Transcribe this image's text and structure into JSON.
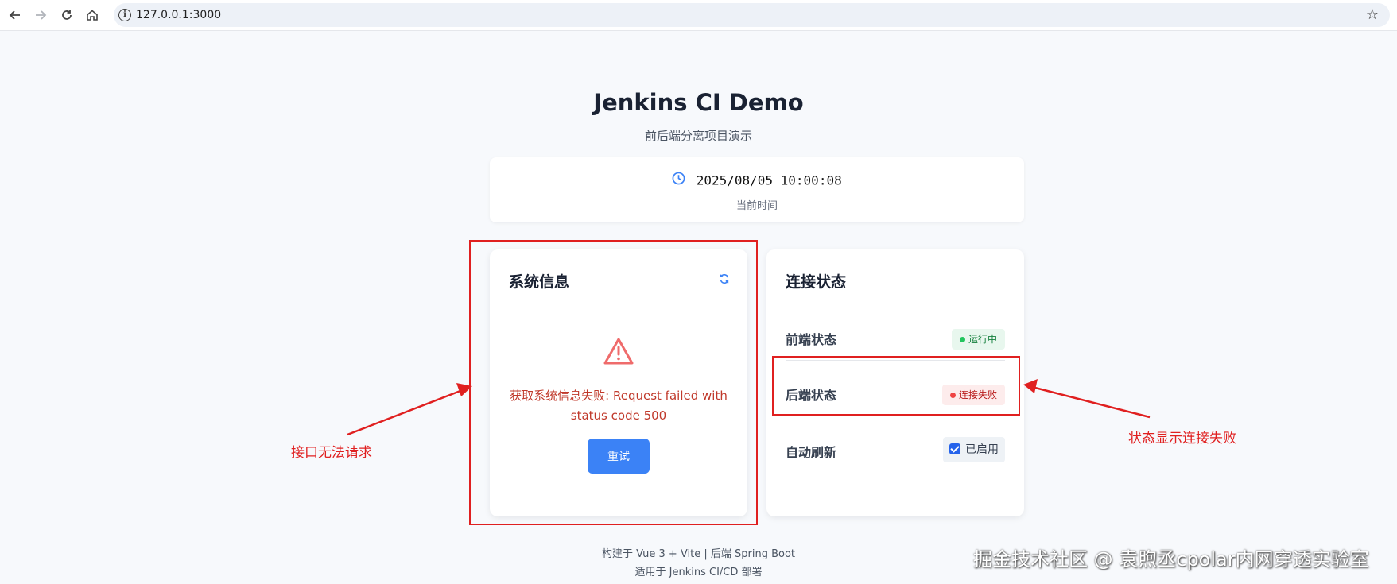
{
  "browser": {
    "url": "127.0.0.1:3000",
    "icons": [
      "back-icon",
      "forward-icon",
      "reload-icon",
      "home-icon",
      "site-info-icon",
      "bookmark-star-icon"
    ]
  },
  "header": {
    "title": "Jenkins CI Demo",
    "subtitle": "前后端分离项目演示"
  },
  "clock": {
    "time": "2025/08/05 10:00:08",
    "label": "当前时间"
  },
  "system_info": {
    "title": "系统信息",
    "error_message": "获取系统信息失败: Request failed with status code 500",
    "retry_label": "重试"
  },
  "connection": {
    "title": "连接状态",
    "rows": [
      {
        "label": "前端状态",
        "status": "运行中",
        "state": "ok"
      },
      {
        "label": "后端状态",
        "status": "连接失败",
        "state": "fail"
      },
      {
        "label": "自动刷新",
        "status": "已启用",
        "state": "checked"
      }
    ]
  },
  "footer": {
    "line1": "构建于 Vue 3 + Vite | 后端 Spring Boot",
    "line2": "适用于 Jenkins CI/CD 部署"
  },
  "annotations": {
    "left_note": "接口无法请求",
    "right_note": "状态显示连接失败",
    "color": "#e02020"
  },
  "watermark": "掘金技术社区 @ 袁煦丞cpolar内网穿透实验室",
  "colors": {
    "accent": "#3b82f6",
    "error": "#c0392b",
    "success": "#22c55e"
  }
}
